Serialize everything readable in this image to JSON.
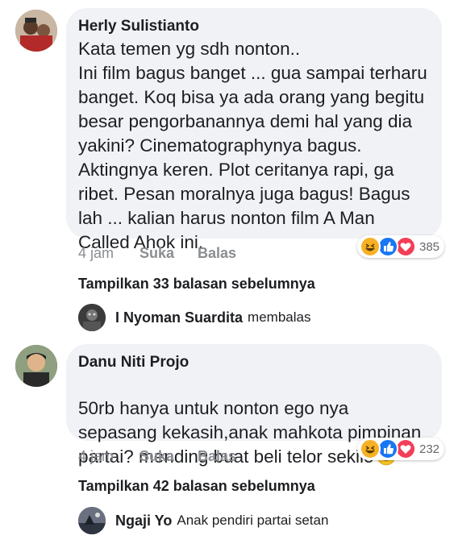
{
  "comments": [
    {
      "author": "Herly Sulistianto",
      "text": "Kata temen yg sdh nonton..\nIni film bagus banget ... gua sampai terharu banget. Koq bisa ya ada orang yang begitu besar pengorbanannya demi hal yang dia yakini? Cinematographynya bagus. Aktingnya keren. Plot ceritanya rapi, ga ribet. Pesan moralnya juga bagus! Bagus lah ... kalian harus nonton film A Man Called Ahok ini.",
      "time": "4 jam",
      "like_label": "Suka",
      "reply_label": "Balas",
      "reaction_count": "385",
      "reaction_icons": [
        "haha-icon",
        "like-icon",
        "love-icon"
      ],
      "show_more": "Tampilkan 33 balasan sebelumnya",
      "reply": {
        "author": "I Nyoman Suardita",
        "text": "membalas"
      }
    },
    {
      "author": "Danu Niti Projo",
      "text": "50rb hanya untuk nonton ego nya sepasang kekasih,anak mahkota pimpinan partai? mending buat beli telor sekilo",
      "trailing_emoji": "smile-emoji-icon",
      "time": "4 jam",
      "like_label": "Suka",
      "reply_label": "Balas",
      "reaction_count": "232",
      "reaction_icons": [
        "haha-icon",
        "like-icon",
        "love-icon"
      ],
      "show_more": "Tampilkan 42 balasan sebelumnya",
      "reply": {
        "author": "Ngaji Yo",
        "text": "Anak pendiri partai setan"
      }
    }
  ],
  "colors": {
    "bubble": "#f0f2f5",
    "meta": "#8a8d91",
    "like_blue": "#1877f2",
    "love_red": "#f33e58",
    "haha_yellow": "#f7b125"
  }
}
